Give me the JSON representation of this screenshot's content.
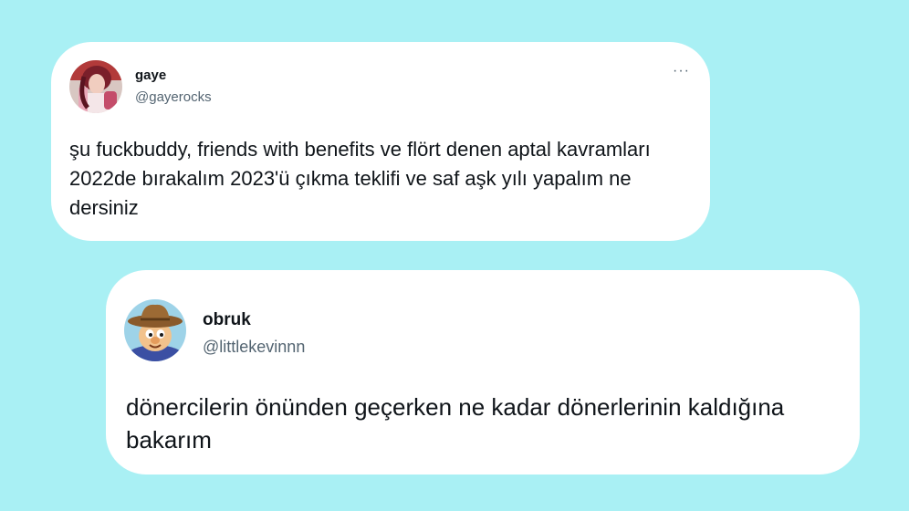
{
  "tweets": [
    {
      "name": "gaye",
      "handle": "@gayerocks",
      "text": "şu fuckbuddy, friends with benefits ve flört denen aptal kavramları 2022de bırakalım 2023'ü çıkma teklifi ve saf aşk yılı yapalım ne dersiniz",
      "more_label": "···",
      "avatar_icon": "profile-photo-gaye"
    },
    {
      "name": "obruk",
      "handle": "@littlekevinnn",
      "text": "dönercilerin önünden geçerken ne kadar dönerlerinin kaldığına bakarım",
      "avatar_icon": "profile-photo-cowboy-cartoon"
    }
  ],
  "colors": {
    "background": "#a9f0f4",
    "card": "#ffffff",
    "text": "#0f1419",
    "secondary_text": "#536471"
  }
}
